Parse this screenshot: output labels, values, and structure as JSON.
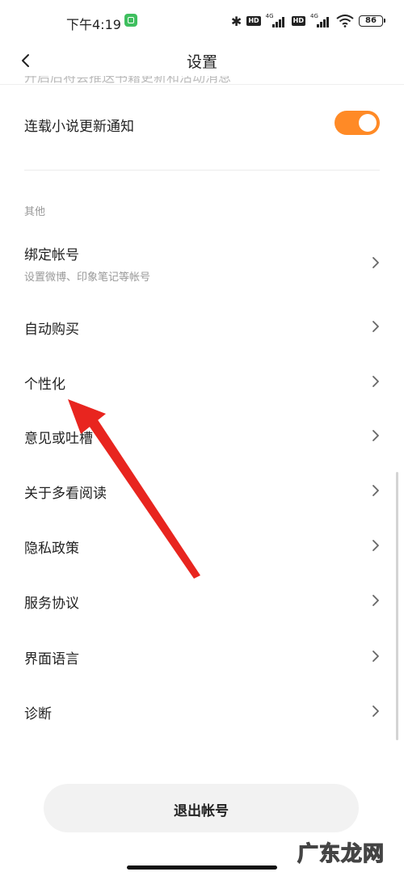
{
  "status_bar": {
    "time": "下午4:19",
    "bluetooth_icon": "bluetooth-icon",
    "hd_label": "HD",
    "network_gen": "4G",
    "battery": "86",
    "wifi_icon": "wifi-icon"
  },
  "header": {
    "title": "设置",
    "back_icon": "chevron-left-icon"
  },
  "clipped_row_text": "开启后将会推送书籍更新和活动消息",
  "toggle_row": {
    "label": "连载小说更新通知",
    "state": "on",
    "accent_color": "#ff8a26"
  },
  "section": {
    "header": "其他"
  },
  "items": [
    {
      "label": "绑定帐号",
      "sublabel": "设置微博、印象笔记等帐号"
    },
    {
      "label": "自动购买"
    },
    {
      "label": "个性化"
    },
    {
      "label": "意见或吐槽"
    },
    {
      "label": "关于多看阅读"
    },
    {
      "label": "隐私政策"
    },
    {
      "label": "服务协议"
    },
    {
      "label": "界面语言"
    },
    {
      "label": "诊断"
    }
  ],
  "logout": {
    "label": "退出帐号"
  },
  "annotation": {
    "arrow_color": "#e8251f"
  },
  "watermark": "广东龙网"
}
